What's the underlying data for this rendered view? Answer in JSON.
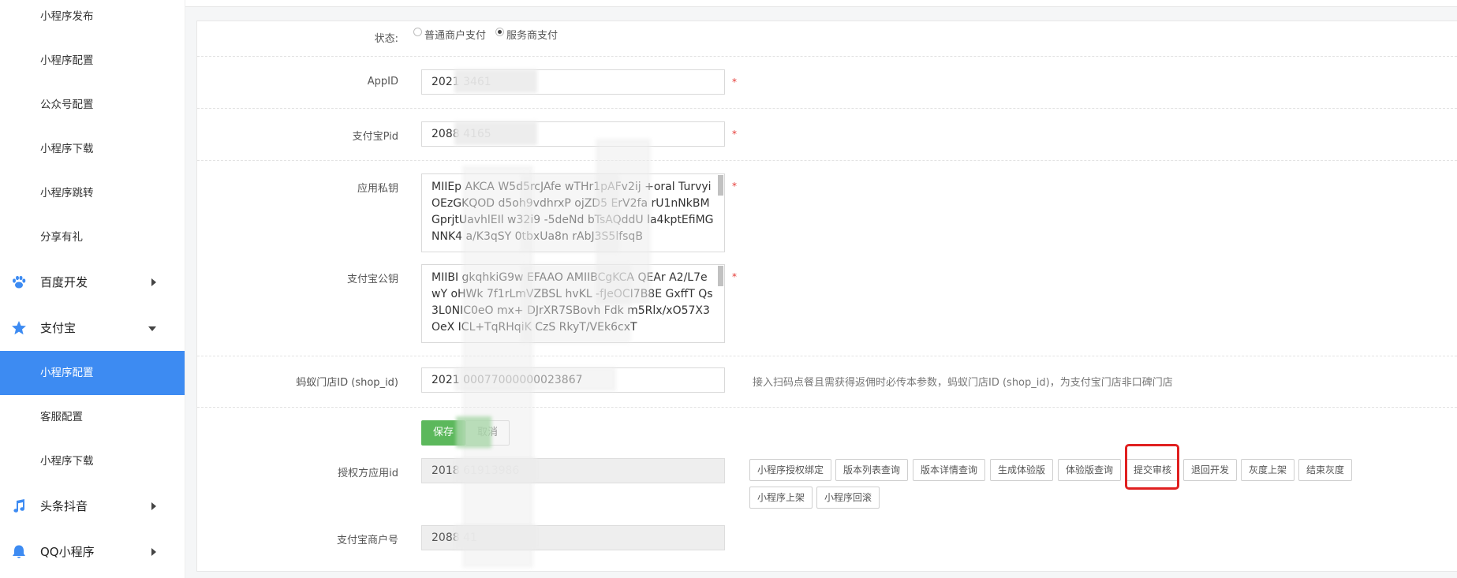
{
  "sidebar": {
    "items": [
      {
        "label": "小程序发布",
        "type": "sub"
      },
      {
        "label": "小程序配置",
        "type": "sub"
      },
      {
        "label": "公众号配置",
        "type": "sub"
      },
      {
        "label": "小程序下载",
        "type": "sub"
      },
      {
        "label": "小程序跳转",
        "type": "sub"
      },
      {
        "label": "分享有礼",
        "type": "sub"
      },
      {
        "label": "百度开发",
        "type": "group",
        "icon": "paw-icon",
        "arrow": "right"
      },
      {
        "label": "支付宝",
        "type": "group",
        "icon": "star-icon",
        "arrow": "down"
      },
      {
        "label": "小程序配置",
        "type": "sub",
        "active": true
      },
      {
        "label": "客服配置",
        "type": "sub"
      },
      {
        "label": "小程序下载",
        "type": "sub"
      },
      {
        "label": "头条抖音",
        "type": "group",
        "icon": "music-note-icon",
        "arrow": "right"
      },
      {
        "label": "QQ小程序",
        "type": "group",
        "icon": "bell-icon",
        "arrow": "right"
      }
    ],
    "accent_color": "#3d8bf2"
  },
  "form": {
    "status": {
      "label": "状态:",
      "options": [
        {
          "label": "普通商户支付",
          "checked": false
        },
        {
          "label": "服务商支付",
          "checked": true
        }
      ]
    },
    "appid": {
      "label": "AppID",
      "value": "2021  3461"
    },
    "alipay_pid": {
      "label": "支付宝Pid",
      "value": "2088  4165"
    },
    "private_key": {
      "label": "应用私钥",
      "value": "MIIEp AKCA W5d5rcJAfe wTHr1pAFv2ij +oral Turvyi OEzGKQOD d5oh9vdhrxP ojZD5 ErV2fa rU1nNkBM GprjtUavhlEIl w32i9 -5deNd bTsAQddU la4kptEfiMG NNK4 a/K3qSY 0tbxUa8n rAbJ3S5lfsqB"
    },
    "alipay_public_key": {
      "label": "支付宝公钥",
      "value": "MIIBI gkqhkiG9w EFAAO AMIIBCgKCA QEAr A2/L7ewY oHWk 7f1rLmVZBSL hvKL -fJeOCI7B8E GxffT Qs3L0NIC0eO mx+ DJrXR7SBovh Fdk m5Rlx/xO57X3 OeX ICL+TqRHqiK CzS RkyT/VEk6cxT"
    },
    "shop_id": {
      "label": "蚂蚁门店ID (shop_id)",
      "value": "2021  00077000000023867",
      "hint": "接入扫码点餐且需获得返佣时必传本参数，蚂蚁门店ID (shop_id)，为支付宝门店非口碑门店"
    },
    "save_label": "保存",
    "cancel_label": "取消",
    "auth_app_id": {
      "label": "授权方应用id",
      "value": "2018  61913986"
    },
    "merchant_no": {
      "label": "支付宝商户号",
      "value": "2088  41"
    }
  },
  "actions": [
    "小程序授权绑定",
    "版本列表查询",
    "版本详情查询",
    "生成体验版",
    "体验版查询",
    "提交审核",
    "退回开发",
    "灰度上架",
    "结束灰度",
    "小程序上架",
    "小程序回滚"
  ],
  "colors": {
    "save_button": "#5cb85c",
    "required_mark": "#e53935",
    "highlight": "#e02020"
  }
}
